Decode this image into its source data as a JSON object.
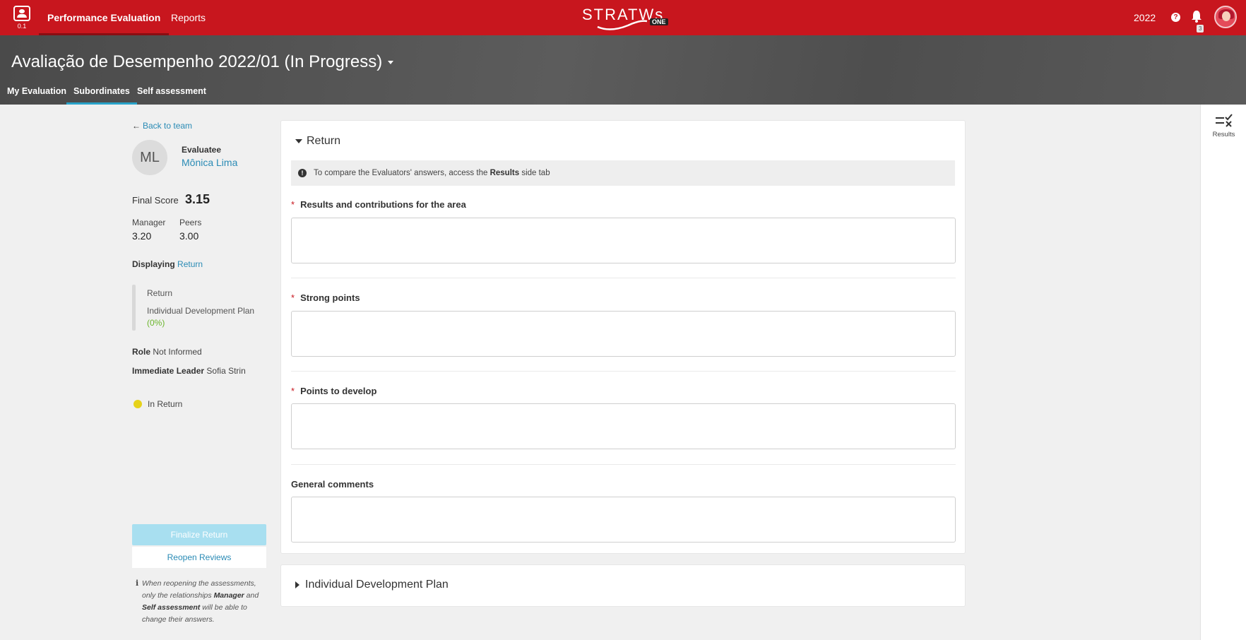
{
  "topbar": {
    "app_version": "0.1",
    "nav": [
      "Performance Evaluation",
      "Reports"
    ],
    "logo_text": "STRATWs",
    "logo_badge": "ONE",
    "year": "2022",
    "notification_count": "3"
  },
  "header": {
    "title": "Avaliação de Desempenho 2022/01 (In Progress)",
    "tabs": [
      "My Evaluation",
      "Subordinates",
      "Self assessment"
    ],
    "active_tab": "Subordinates"
  },
  "sidebar": {
    "back_link": "Back to team",
    "avatar_initials": "ML",
    "evaluatee_label": "Evaluatee",
    "evaluatee_name": "Mônica Lima",
    "final_score_label": "Final Score",
    "final_score": "3.15",
    "manager_label": "Manager",
    "manager_score": "3.20",
    "peers_label": "Peers",
    "peers_score": "3.00",
    "displaying_label": "Displaying",
    "displaying_value": "Return",
    "sections": [
      "Return",
      "Individual Development Plan"
    ],
    "idp_progress": "(0%)",
    "role_label": "Role",
    "role_value": "Not Informed",
    "leader_label": "Immediate Leader",
    "leader_value": "Sofia Strin",
    "status": "In Return",
    "status_color": "#e6d21a",
    "finalize_button": "Finalize Return",
    "reopen_button": "Reopen Reviews",
    "note_parts": {
      "a": "When reopening the assessments, only the relationships ",
      "b": "Manager",
      "c": " and ",
      "d": "Self assessment",
      "e": " will be able to change their answers."
    }
  },
  "main": {
    "section_title": "Return",
    "info_parts": {
      "a": "To compare the Evaluators' answers, access the ",
      "b": "Results",
      "c": " side tab"
    },
    "fields": [
      {
        "label": "Results and contributions for the area",
        "required": "*",
        "value": ""
      },
      {
        "label": "Strong points",
        "required": "*",
        "value": ""
      },
      {
        "label": "Points to develop",
        "required": "*",
        "value": ""
      },
      {
        "label": "General comments",
        "required": "",
        "value": ""
      }
    ],
    "collapsed_section_title": "Individual Development Plan"
  },
  "rail": {
    "results_label": "Results"
  },
  "colors": {
    "brand_red": "#c8161e",
    "link_blue": "#2a8bb5",
    "progress_green": "#6ab52b"
  }
}
